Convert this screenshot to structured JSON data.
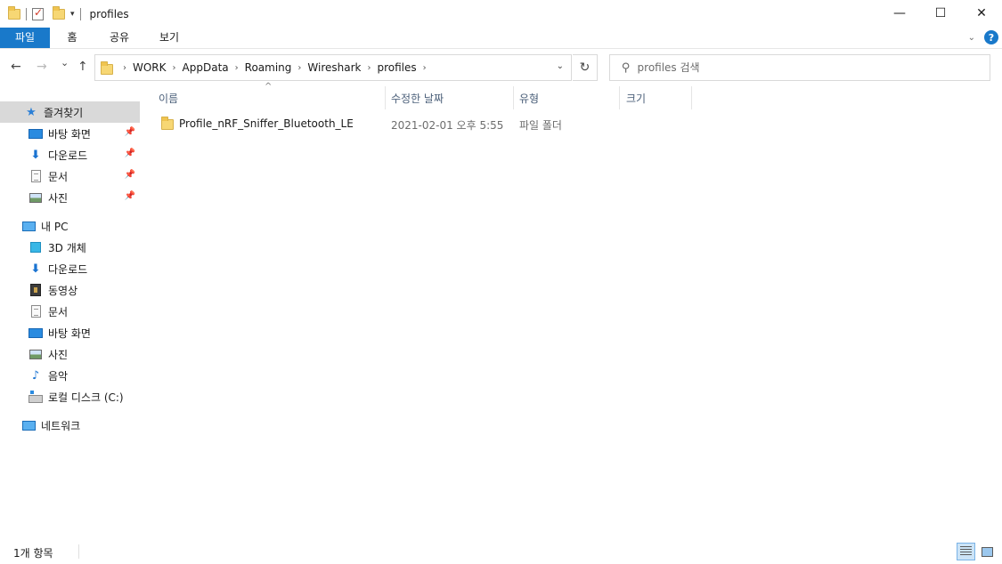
{
  "window": {
    "title": "profiles",
    "minimize_glyph": "—",
    "maximize_glyph": "☐",
    "close_glyph": "✕"
  },
  "ribbon": {
    "tabs": [
      {
        "label": "파일"
      },
      {
        "label": "홈"
      },
      {
        "label": "공유"
      },
      {
        "label": "보기"
      }
    ],
    "help_glyph": "?"
  },
  "nav": {
    "back_glyph": "←",
    "forward_glyph": "→",
    "recent_glyph": "⌄",
    "up_glyph": "↑",
    "refresh_glyph": "↻"
  },
  "address": {
    "breadcrumbs": [
      "WORK",
      "AppData",
      "Roaming",
      "Wireshark",
      "profiles"
    ]
  },
  "search": {
    "placeholder": "profiles 검색"
  },
  "sidebar": {
    "quick_access": {
      "label": "즐겨찾기",
      "items": [
        {
          "label": "바탕 화면",
          "icon": "desktop-icon",
          "pinned": true
        },
        {
          "label": "다운로드",
          "icon": "download-icon",
          "pinned": true
        },
        {
          "label": "문서",
          "icon": "document-icon",
          "pinned": true
        },
        {
          "label": "사진",
          "icon": "pictures-icon",
          "pinned": true
        }
      ]
    },
    "this_pc": {
      "label": "내 PC",
      "items": [
        {
          "label": "3D 개체",
          "icon": "3d-objects-icon"
        },
        {
          "label": "다운로드",
          "icon": "download-icon"
        },
        {
          "label": "동영상",
          "icon": "videos-icon"
        },
        {
          "label": "문서",
          "icon": "document-icon"
        },
        {
          "label": "바탕 화면",
          "icon": "desktop-icon"
        },
        {
          "label": "사진",
          "icon": "pictures-icon"
        },
        {
          "label": "음악",
          "icon": "music-icon"
        },
        {
          "label": "로컬 디스크 (C:)",
          "icon": "drive-icon"
        }
      ]
    },
    "network": {
      "label": "네트워크"
    }
  },
  "columns": {
    "name": "이름",
    "modified": "수정한 날짜",
    "type": "유형",
    "size": "크기"
  },
  "files": [
    {
      "name": "Profile_nRF_Sniffer_Bluetooth_LE",
      "modified": "2021-02-01 오후 5:55",
      "type": "파일 폴더",
      "size": ""
    }
  ],
  "status": {
    "item_count": "1개 항목"
  }
}
